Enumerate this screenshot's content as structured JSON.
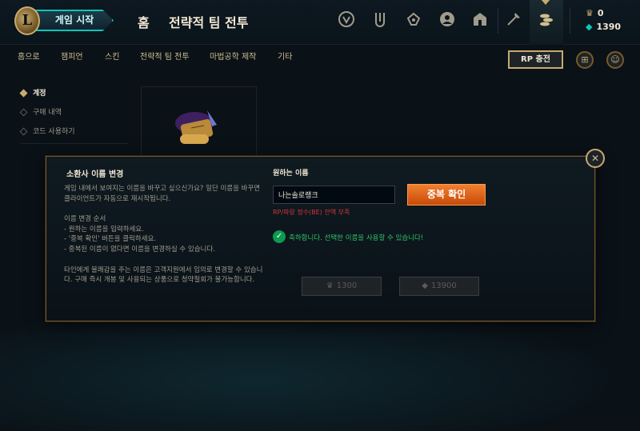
{
  "header": {
    "logo_text": "L",
    "play_button": "게임 시작",
    "home": "홈",
    "tft": "전략적 팀 전투",
    "icons": [
      "mission-icon",
      "collection-icon",
      "loot-icon",
      "profile-icon",
      "store-icon",
      "crafting-icon",
      "coins-icon"
    ],
    "rp_amount": "0",
    "be_amount": "1390"
  },
  "subnav": {
    "items": [
      "홈으로",
      "챔피언",
      "스킨",
      "전략적 팀 전투",
      "마법공학 제작",
      "기타"
    ],
    "rp_button": "RP 충전"
  },
  "sidebar": {
    "items": [
      "계정",
      "구매 내역",
      "코드 사용하기"
    ]
  },
  "modal": {
    "title": "소환사 이름 변경",
    "desc1": "게임 내에서 보여지는 이름을 바꾸고 싶으신가요? 일단 이름을 바꾸면 클라이언트가 자동으로 재시작됩니다.",
    "desc2_title": "이름 변경 순서",
    "desc2_lines": [
      "- 원하는 이름을 입력하세요.",
      "- '중복 확인' 버튼을 클릭하세요.",
      "- 중복된 이름이 없다면 이름을 변경하실 수 있습니다."
    ],
    "desc3": "타인에게 불쾌감을 주는 이름은 고객지원에서 임의로 변경할 수 있습니다. 구매 즉시 개봉 및 사용되는 상품으로 청약철회가 불가능합니다.",
    "want_label": "원하는 이름",
    "name_value": "나는솔로랭크",
    "check_button": "중복 확인",
    "warning": "RP/파랑 정수(BE) 잔액 부족",
    "success": "축하합니다. 선택한 이름을 사용할 수 있습니다!",
    "price_rp": "1300",
    "price_be": "13900"
  },
  "colors": {
    "gold": "#c8aa6e",
    "teal": "#0ac8b9",
    "orange_button": "#e06a1c",
    "success_green": "#2fc46a",
    "warning_red": "#d13639"
  }
}
